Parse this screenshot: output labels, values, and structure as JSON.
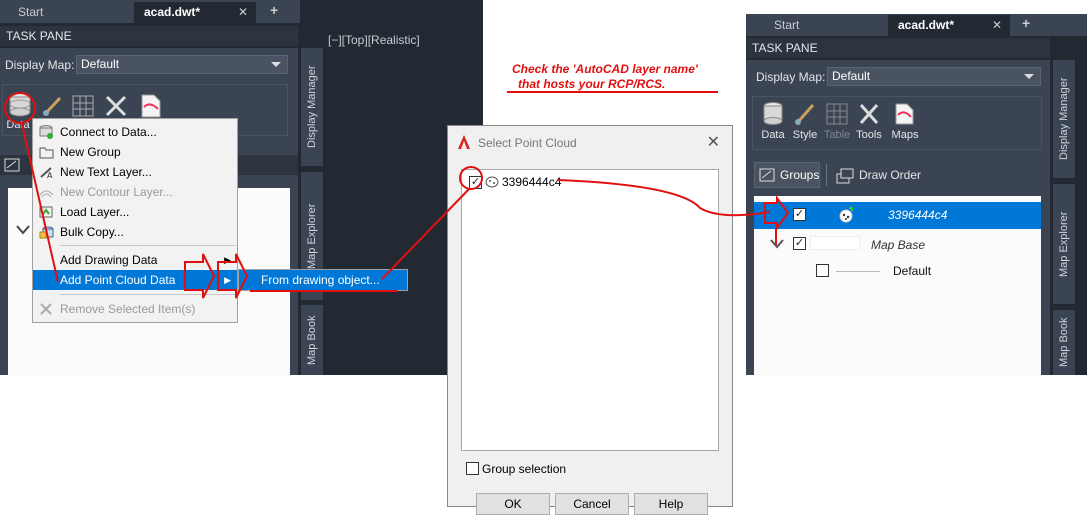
{
  "left_window": {
    "tabs": [
      {
        "label": "Start"
      },
      {
        "label": "acad.dwt*"
      }
    ],
    "close_glyph": "✕",
    "plus_glyph": "+",
    "task_pane_title": "TASK PANE",
    "display_map_label": "Display Map:",
    "display_map_value": "Default",
    "tools": [
      {
        "label": "Data"
      }
    ],
    "viewport_label": "[−][Top][Realistic]",
    "side_tabs": [
      "Display Manager",
      "Map Explorer",
      "Map Book"
    ]
  },
  "context_menu": {
    "items": [
      {
        "label": "Connect to Data...",
        "disabled": false
      },
      {
        "label": "New Group",
        "disabled": false
      },
      {
        "label": "New Text Layer...",
        "disabled": false
      },
      {
        "label": "New Contour Layer...",
        "disabled": true
      },
      {
        "label": "Load Layer...",
        "disabled": false
      },
      {
        "label": "Bulk Copy...",
        "disabled": false
      },
      {
        "label": "Add Drawing Data",
        "disabled": false
      },
      {
        "label": "Add Point Cloud Data",
        "disabled": false
      },
      {
        "label": "Remove Selected Item(s)",
        "disabled": true
      }
    ],
    "submenu_item": "From drawing object..."
  },
  "annotation": {
    "line1": "Check the 'AutoCAD layer name'",
    "line2": "that hosts your RCP/RCS."
  },
  "dialog": {
    "title": "Select Point Cloud",
    "close_glyph": "✕",
    "item_label": "3396444c4",
    "group_selection_label": "Group selection",
    "buttons": [
      "OK",
      "Cancel",
      "Help"
    ]
  },
  "right_window": {
    "tabs": [
      {
        "label": "Start"
      },
      {
        "label": "acad.dwt*"
      }
    ],
    "close_glyph": "✕",
    "plus_glyph": "+",
    "task_pane_title": "TASK PANE",
    "display_map_label": "Display Map:",
    "display_map_value": "Default",
    "tools": [
      {
        "label": "Data",
        "disabled": false
      },
      {
        "label": "Style",
        "disabled": false
      },
      {
        "label": "Table",
        "disabled": true
      },
      {
        "label": "Tools",
        "disabled": false
      },
      {
        "label": "Maps",
        "disabled": false
      }
    ],
    "groups_label": "Groups",
    "draw_order_label": "Draw Order",
    "tree": [
      {
        "label": "3396444c4",
        "checked": true,
        "selected": true
      },
      {
        "label": "Map Base",
        "checked": true,
        "selected": false
      },
      {
        "label": "Default",
        "checked": false,
        "selected": false
      }
    ],
    "side_tabs": [
      "Display Manager",
      "Map Explorer",
      "Map Book"
    ]
  },
  "colors": {
    "dark_bg": "#222933",
    "panel_bg": "#3b4452",
    "selection": "#0078d7",
    "annotation_red": "#e01010"
  }
}
